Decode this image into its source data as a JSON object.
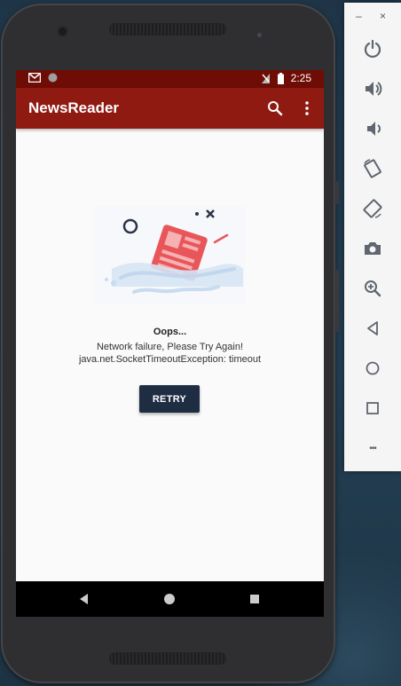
{
  "status_bar": {
    "time": "2:25"
  },
  "app_bar": {
    "title": "NewsReader"
  },
  "error": {
    "title": "Oops...",
    "message": "Network failure, Please Try Again!",
    "detail": "java.net.SocketTimeoutException: timeout",
    "retry_label": "RETRY"
  },
  "emulator_panel": {
    "minimize_label": "–",
    "close_label": "×",
    "more_label": "•••",
    "tools": [
      "power-icon",
      "volume-up-icon",
      "volume-down-icon",
      "rotate-left-icon",
      "rotate-right-icon",
      "camera-icon",
      "zoom-icon",
      "back-icon",
      "home-icon",
      "overview-icon",
      "more-icon"
    ]
  },
  "colors": {
    "status_bar": "#6d0d05",
    "app_bar": "#8f1a12",
    "retry_button": "#1e2d42",
    "screen_bg": "#fafafa"
  }
}
